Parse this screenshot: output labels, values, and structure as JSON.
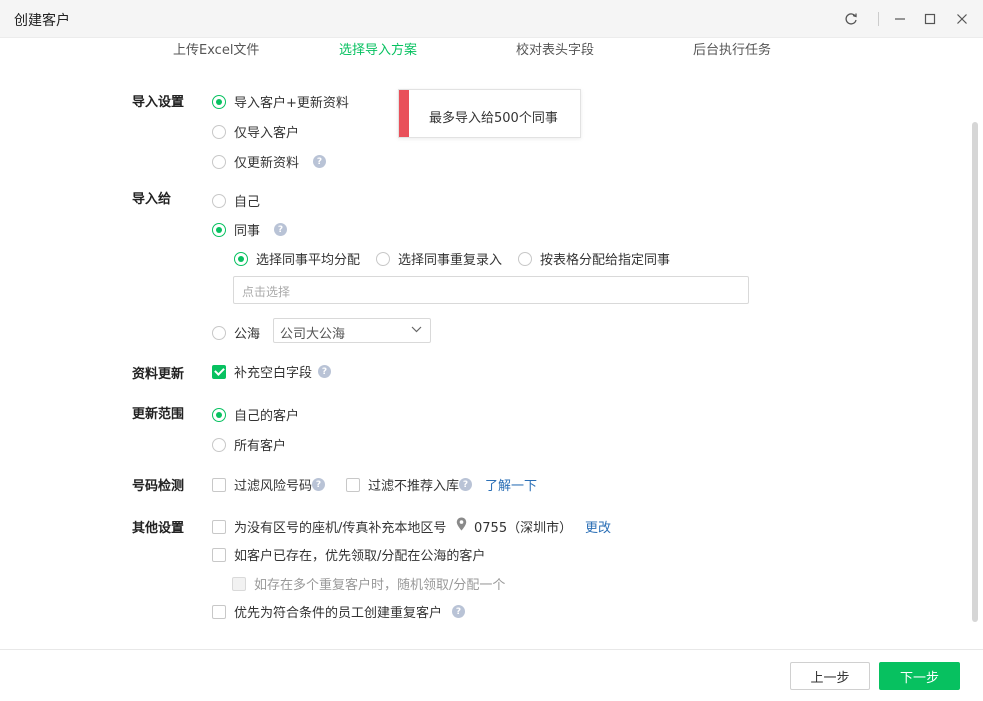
{
  "window": {
    "title": "创建客户"
  },
  "steps": [
    "上传Excel文件",
    "选择导入方案",
    "校对表头字段",
    "后台执行任务"
  ],
  "import_settings": {
    "label": "导入设置",
    "options": [
      "导入客户+更新资料",
      "仅导入客户",
      "仅更新资料"
    ],
    "tooltip": "最多导入给500个同事"
  },
  "import_to": {
    "label": "导入给",
    "self": "自己",
    "colleague": "同事",
    "colleague_modes": [
      "选择同事平均分配",
      "选择同事重复录入",
      "按表格分配给指定同事"
    ],
    "picker_placeholder": "点击选择",
    "sea": "公海",
    "sea_select_value": "公司大公海"
  },
  "data_update": {
    "label": "资料更新",
    "fill_blank": "补充空白字段"
  },
  "update_scope": {
    "label": "更新范围",
    "options": [
      "自己的客户",
      "所有客户"
    ]
  },
  "number_check": {
    "label": "号码检测",
    "filter_risk": "过滤风险号码",
    "filter_not_recommended": "过滤不推荐入库",
    "learn_more": "了解一下"
  },
  "other_settings": {
    "label": "其他设置",
    "area_code": "为没有区号的座机/传真补充本地区号",
    "area_value": "0755（深圳市）",
    "change": "更改",
    "prefer_claim": "如客户已存在，优先领取/分配在公海的客户",
    "random_claim": "如存在多个重复客户时，随机领取/分配一个",
    "create_duplicate": "优先为符合条件的员工创建重复客户"
  },
  "footer": {
    "prev": "上一步",
    "next": "下一步"
  },
  "colors": {
    "accent": "#07c160",
    "warning": "#e9505a",
    "link": "#2b6fb6"
  }
}
